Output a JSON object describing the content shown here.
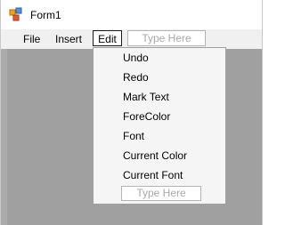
{
  "window": {
    "title": "Form1"
  },
  "menubar": {
    "items": [
      "File",
      "Insert",
      "Edit"
    ],
    "type_here_placeholder": "Type Here"
  },
  "edit_menu": {
    "items": [
      "Undo",
      "Redo",
      "Mark Text",
      "ForeColor",
      "Font",
      "Current Color",
      "Current Font"
    ],
    "type_here_placeholder": "Type Here"
  },
  "icons": {
    "app": "form-app-icon"
  },
  "colors": {
    "client_area": "#a0a0a0",
    "menubar": "#f0f0f0",
    "dropdown": "#f5f5f5",
    "placeholder_text": "#a8a8a8"
  }
}
